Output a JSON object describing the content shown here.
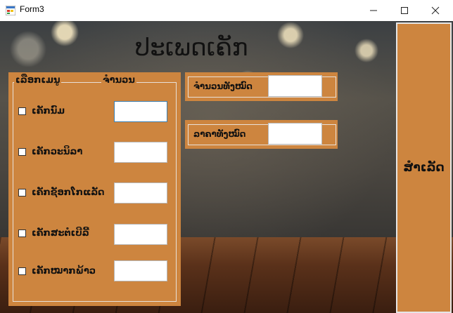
{
  "window": {
    "title": "Form3"
  },
  "header": {
    "title": "ປະເພດເຄັກ"
  },
  "menu_group": {
    "menu_legend": "ເລືອກເມນູ",
    "qty_legend": "ຈໍານວນ",
    "items": [
      {
        "label": "ເຄັກນົມ",
        "qty": ""
      },
      {
        "label": "ເຄັກວະນິລາ",
        "qty": ""
      },
      {
        "label": "ເຄັກຊັອກໂກແລັດ",
        "qty": ""
      },
      {
        "label": "ເຄັກສະຕໍເບີລີ້",
        "qty": ""
      },
      {
        "label": "ເຄັກໝາກພ້າວ",
        "qty": ""
      }
    ]
  },
  "totals": {
    "quantity_label": "ຈໍານວນທັງໝົດ",
    "quantity_value": "",
    "price_label": "ລາຄາທັງໝົດ",
    "price_value": ""
  },
  "actions": {
    "finish_label": "ສໍາເລັດ"
  },
  "colors": {
    "panel": "#cd853f"
  }
}
